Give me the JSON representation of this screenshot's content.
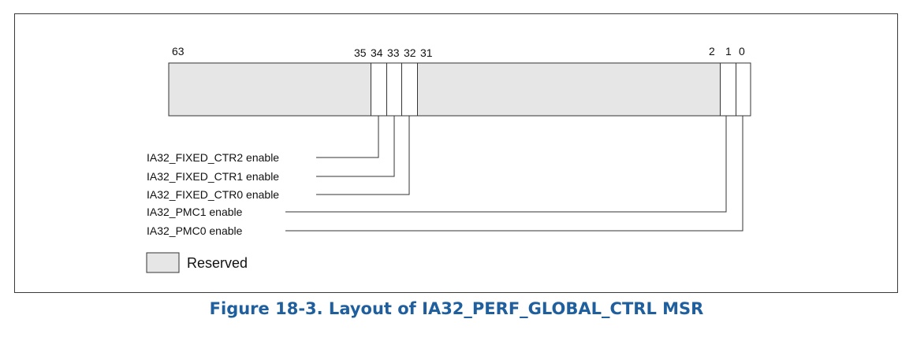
{
  "diagram": {
    "bit_labels": {
      "b63": "63",
      "b35": "35",
      "b34": "34",
      "b33": "33",
      "b32": "32",
      "b31": "31",
      "b2": "2",
      "b1": "1",
      "b0": "0"
    },
    "fields": [
      {
        "label": "IA32_FIXED_CTR2 enable",
        "bit": 34
      },
      {
        "label": "IA32_FIXED_CTR1 enable",
        "bit": 33
      },
      {
        "label": "IA32_FIXED_CTR0 enable",
        "bit": 32
      },
      {
        "label": "IA32_PMC1 enable",
        "bit": 1
      },
      {
        "label": "IA32_PMC0 enable",
        "bit": 0
      }
    ],
    "legend": {
      "reserved_label": "Reserved",
      "reserved_color": "#e6e6e6"
    },
    "caption": "Figure 18-3.  Layout of IA32_PERF_GLOBAL_CTRL MSR",
    "colors": {
      "caption": "#1f5f9e",
      "lines": "#333333",
      "reserved_fill": "#e6e6e6"
    }
  }
}
